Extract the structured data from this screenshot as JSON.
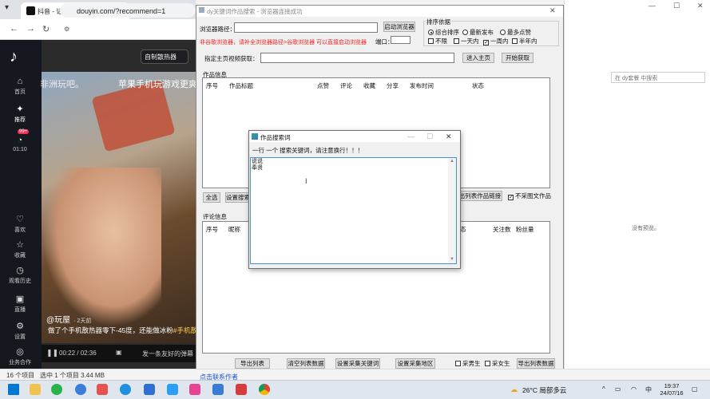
{
  "browser": {
    "tab_title": "抖音 - 记录美好生活",
    "url": "douyin.com/?recommend=1",
    "search_placeholder": "自制散热器"
  },
  "douyin": {
    "nav": [
      {
        "label": "首页",
        "icon": "home-icon"
      },
      {
        "label": "推荐",
        "icon": "recommend-icon"
      },
      {
        "label": "01:10",
        "icon": "timer-icon"
      },
      {
        "label": "喜欢",
        "icon": "heart-icon"
      },
      {
        "label": "收藏",
        "icon": "star-icon"
      },
      {
        "label": "观看历史",
        "icon": "history-icon"
      },
      {
        "label": "直播",
        "icon": "live-icon"
      },
      {
        "label": "设置",
        "icon": "settings-icon"
      },
      {
        "label": "业务合作",
        "icon": "business-icon"
      }
    ],
    "badge": "99+",
    "overlay_left": "非洲玩吧。",
    "overlay_right": "苹果手机玩游戏更爽",
    "author": "@玩屋",
    "author_time": "· 2天前",
    "description": "做了个手机散热器零下-45度，还能做冰粉",
    "hashtag": "#手机散",
    "time": "00:22 / 02:36",
    "danmu_placeholder": "发一条友好的弹幕"
  },
  "statusbar": {
    "items": "16 个项目",
    "selected": "选中 1 个项目  3.44 MB"
  },
  "explorer": {
    "search_placeholder": "在 dy套餐 中搜索",
    "no_preview": "没有预览。"
  },
  "tool": {
    "title": "dy关键词作品搜索 - 浏览器连接成功",
    "browser_path_label": "浏览器路径：",
    "launch_browser": "启动浏览器",
    "notice": "非谷歌浏览器，请补全浏览器路径>谷歌浏览器 可以直接启动浏览器",
    "port_label": "端口：",
    "sort_label": "排序依据",
    "sort_options": [
      "综合排序",
      "最新发布",
      "最多点赞"
    ],
    "time_options": [
      "不限",
      "一天内",
      "一周内",
      "半年内"
    ],
    "homepage_label": "指定主页视频获取：",
    "enter_home": "进入主页",
    "start_fetch": "开始获取",
    "works_title": "作品信息",
    "works_headers": [
      "序号",
      "作品标题",
      "点赞",
      "评论",
      "收藏",
      "分享",
      "发布时间",
      "状态"
    ],
    "select_all": "全选",
    "set_search": "设置搜索",
    "export_works": "出列表作品链接",
    "no_image_works": "不采图文作品",
    "comments_title": "评论信息",
    "comments_headers": [
      "序号",
      "昵称",
      "态",
      "关注数",
      "粉丝量"
    ],
    "export_ms4": "导出列表ms4",
    "clear_list": "清空列表数据",
    "set_keywords": "设置采集关键词",
    "set_region": "设置采集地区",
    "collect_male": "采男生",
    "collect_female": "采女生",
    "export_list": "导出列表数据",
    "contact": "点击联系作者"
  },
  "dialog": {
    "title": "作品搜索词",
    "instruction": "一行 一个 搜索关键词，请注意换行！！！",
    "content": "说说\n奉贤"
  },
  "taskbar": {
    "weather": "26°C  局部多云",
    "ime": "中",
    "time": "19:37",
    "date": "24/07/16"
  }
}
